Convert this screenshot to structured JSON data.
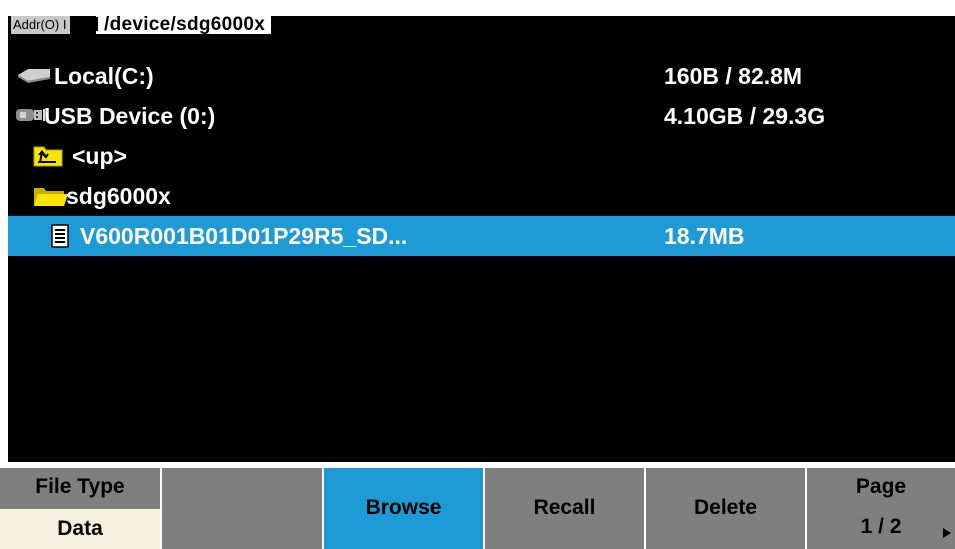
{
  "address": {
    "label": "Addr(O) I",
    "path": "/device/sdg6000x"
  },
  "files": [
    {
      "icon": "drive-icon",
      "name": "Local(C:)",
      "size": "160B / 82.8M",
      "selected": false
    },
    {
      "icon": "usb-drive-icon",
      "name": "USB Device (0:)",
      "size": "4.10GB / 29.3G",
      "selected": false
    },
    {
      "icon": "up-folder-icon",
      "name": "<up>",
      "size": "",
      "selected": false
    },
    {
      "icon": "open-folder-icon",
      "name": "sdg6000x",
      "size": "",
      "selected": false
    },
    {
      "icon": "file-icon",
      "name": "V600R001B01D01P29R5_SD...",
      "size": "18.7MB",
      "selected": true
    }
  ],
  "softkeys": {
    "file_type": {
      "label": "File Type",
      "value": "Data"
    },
    "blank": {
      "label": ""
    },
    "browse": {
      "label": "Browse"
    },
    "recall": {
      "label": "Recall"
    },
    "delete": {
      "label": "Delete"
    },
    "page": {
      "label": "Page",
      "value": "1 / 2"
    }
  },
  "colors": {
    "selection": "#1e9ad6",
    "background": "#000000",
    "softkey": "#7f7f7f",
    "softkey_value": "#f6f1de",
    "folder": "#ffe400"
  }
}
